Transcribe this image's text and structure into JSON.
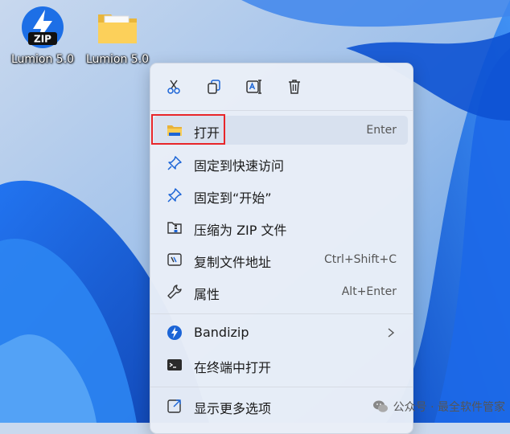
{
  "desktop": {
    "icons": [
      {
        "label": "Lumion 5.0",
        "icon": "zip-archive-icon",
        "badge": "ZIP"
      },
      {
        "label": "Lumion 5.0",
        "icon": "folder-icon"
      }
    ]
  },
  "context_menu": {
    "toolbar": [
      "cut-icon",
      "copy-icon",
      "rename-icon",
      "delete-icon"
    ],
    "items": [
      {
        "label": "打开",
        "shortcut": "Enter",
        "icon": "folder-open-icon"
      },
      {
        "label": "固定到快速访问",
        "shortcut": "",
        "icon": "pin-icon"
      },
      {
        "label": "固定到“开始”",
        "shortcut": "",
        "icon": "pin-icon"
      },
      {
        "label": "压缩为 ZIP 文件",
        "shortcut": "",
        "icon": "zip-compress-icon"
      },
      {
        "label": "复制文件地址",
        "shortcut": "Ctrl+Shift+C",
        "icon": "copy-path-icon"
      },
      {
        "label": "属性",
        "shortcut": "Alt+Enter",
        "icon": "wrench-icon"
      },
      {
        "label": "Bandizip",
        "shortcut": "",
        "icon": "bandizip-icon",
        "submenu": true
      },
      {
        "label": "在终端中打开",
        "shortcut": "",
        "icon": "terminal-icon"
      },
      {
        "label": "显示更多选项",
        "shortcut": "",
        "icon": "more-options-icon"
      }
    ]
  },
  "watermark": {
    "text": "公众号 · 最全软件管家"
  },
  "colors": {
    "highlight": "#e8262a",
    "accent": "#0a5fd0"
  }
}
